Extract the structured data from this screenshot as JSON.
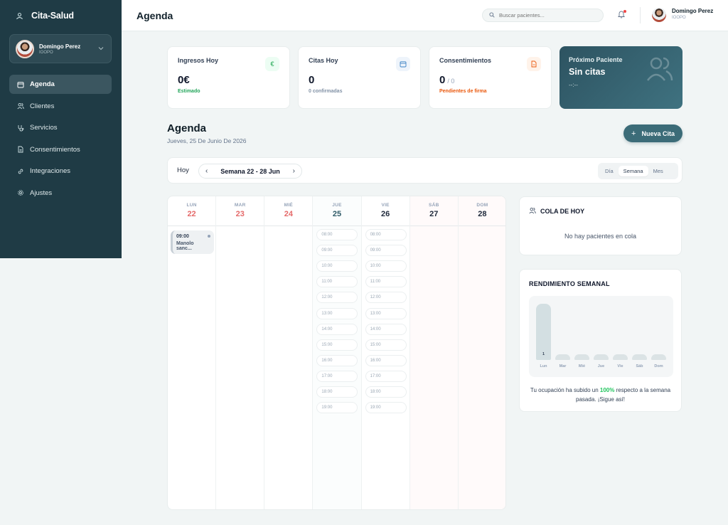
{
  "app": {
    "name": "Cita-Salud"
  },
  "user": {
    "name": "Domingo Perez",
    "role": "IOOPO"
  },
  "sidebar": {
    "items": [
      {
        "label": "Agenda",
        "icon": "calendar-icon",
        "active": true
      },
      {
        "label": "Clientes",
        "icon": "users-icon"
      },
      {
        "label": "Servicios",
        "icon": "stethoscope-icon"
      },
      {
        "label": "Consentimientos",
        "icon": "document-icon"
      },
      {
        "label": "Integraciones",
        "icon": "link-icon"
      },
      {
        "label": "Ajustes",
        "icon": "gear-icon"
      }
    ]
  },
  "header": {
    "title": "Agenda",
    "search_placeholder": "Buscar pacientes..."
  },
  "stats": [
    {
      "label": "Ingresos Hoy",
      "value": "0€",
      "sub": "Estimado",
      "icon": "euro-icon",
      "color": "#16a34a"
    },
    {
      "label": "Citas Hoy",
      "value": "0",
      "sub": "0 confirmadas",
      "icon": "calendar-icon",
      "color": "#64748b"
    },
    {
      "label": "Consentimientos",
      "value": "0",
      "value_suffix": "/ 0",
      "sub": "Pendientes de firma",
      "icon": "file-icon",
      "color": "#ea580c"
    }
  ],
  "next_patient": {
    "label": "Próximo Paciente",
    "value": "Sin citas",
    "time": "--:--"
  },
  "agenda": {
    "title": "Agenda",
    "date": "Jueves, 25 De Junio De 2026",
    "new_button": "Nueva Cita",
    "today_label": "Hoy",
    "week_range": "Semana 22 - 28 Jun",
    "views": [
      "Día",
      "Semana",
      "Mes"
    ],
    "selected_view": "Semana"
  },
  "calendar": {
    "days": [
      {
        "name": "LUN",
        "num": "22",
        "style": "red"
      },
      {
        "name": "MAR",
        "num": "23",
        "style": "red"
      },
      {
        "name": "MIÉ",
        "num": "24",
        "style": "red"
      },
      {
        "name": "JUE",
        "num": "25",
        "style": "teal"
      },
      {
        "name": "VIE",
        "num": "26",
        "style": "dark"
      },
      {
        "name": "SÁB",
        "num": "27",
        "style": "dark"
      },
      {
        "name": "DOM",
        "num": "28",
        "style": "dark"
      }
    ],
    "event": {
      "time": "09:00",
      "patient": "Manolo sanc..."
    },
    "slots": [
      "08:00",
      "09:00",
      "10:00",
      "11:00",
      "12:00",
      "13:00",
      "14:00",
      "15:00",
      "16:00",
      "17:00",
      "18:00",
      "19:00"
    ]
  },
  "queue": {
    "title": "COLA DE HOY",
    "empty": "No hay pacientes en cola"
  },
  "performance": {
    "title": "RENDIMIENTO SEMANAL",
    "note_pre": "Tu ocupación ha subido un ",
    "note_pct": "100%",
    "note_post": " respecto a la semana pasada. ¡Sigue así!"
  },
  "chart_data": {
    "type": "bar",
    "categories": [
      "Lun",
      "Mar",
      "Mié",
      "Jue",
      "Vie",
      "Sáb",
      "Dom"
    ],
    "values": [
      1,
      0,
      0,
      0,
      0,
      0,
      0
    ],
    "data_labels": [
      "1",
      "",
      "",
      "",
      "",
      "",
      ""
    ]
  }
}
